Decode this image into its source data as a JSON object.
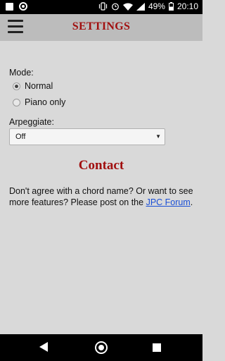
{
  "status_bar": {
    "battery_percent": "49%",
    "time": "20:10",
    "icons": [
      "square-notification-icon",
      "circle-notification-icon",
      "vibrate-icon",
      "alarm-icon",
      "wifi-icon",
      "signal-icon",
      "battery-icon"
    ]
  },
  "app_bar": {
    "title": "SETTINGS",
    "menu_icon": "hamburger-menu-icon"
  },
  "settings": {
    "mode_label": "Mode:",
    "mode_options": [
      {
        "label": "Normal",
        "checked": true
      },
      {
        "label": "Piano only",
        "checked": false
      }
    ],
    "arpeggiate_label": "Arpeggiate:",
    "arpeggiate_value": "Off"
  },
  "contact": {
    "title": "Contact",
    "text": "Don't agree with a chord name? Or want to see more features? Please post on the ",
    "link_text": "JPC Forum",
    "text_end": "."
  },
  "colors": {
    "accent": "#a10f0f",
    "link": "#1a4fd6",
    "background": "#d9d9d9",
    "app_bar": "#bcbcbc"
  },
  "nav_bar": {
    "icons": [
      "back-icon",
      "home-icon",
      "recent-apps-icon"
    ]
  }
}
